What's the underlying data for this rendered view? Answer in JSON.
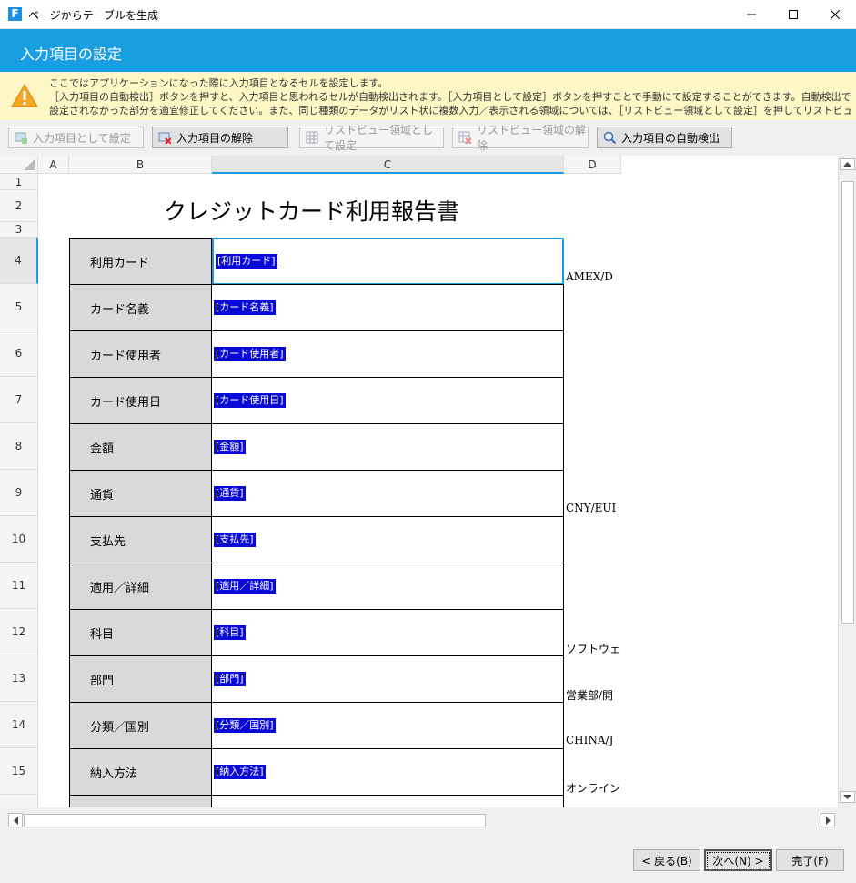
{
  "window": {
    "title": "ページからテーブルを生成",
    "app_icon_letter": "F"
  },
  "header": {
    "title": "入力項目の設定"
  },
  "info": {
    "lines": [
      "ここではアプリケーションになった際に入力項目となるセルを設定します。",
      "［入力項目の自動検出］ボタンを押すと、入力項目と思われるセルが自動検出されます。［入力項目として設定］ボタンを押すことで手動にて設定することができます。自動検出でうまく",
      "設定されなかった部分を適宜修正してください。また、同じ種類のデータがリスト状に複数入力／表示される領域については、［リストビュー領域として設定］を押してリストビュー領域とし…"
    ]
  },
  "toolbar": {
    "set_input": "入力項目として設定",
    "unset_input": "入力項目の解除",
    "set_listview": "リストビュー領域として設定",
    "unset_listview": "リストビュー領域の解除",
    "auto_detect": "入力項目の自動検出"
  },
  "sheet": {
    "columns": [
      "A",
      "B",
      "C",
      "D"
    ],
    "rows": [
      "1",
      "2",
      "3",
      "4",
      "5",
      "6",
      "7",
      "8",
      "9",
      "10",
      "11",
      "12",
      "13",
      "14",
      "15"
    ],
    "report_title": "クレジットカード利用報告書",
    "items": [
      {
        "label": "利用カード",
        "tag": "[利用カード]",
        "d": "AMEX/D"
      },
      {
        "label": "カード名義",
        "tag": "[カード名義]",
        "d": ""
      },
      {
        "label": "カード使用者",
        "tag": "[カード使用者]",
        "d": ""
      },
      {
        "label": "カード使用日",
        "tag": "[カード使用日]",
        "d": ""
      },
      {
        "label": "金額",
        "tag": "[金額]",
        "d": ""
      },
      {
        "label": "通貨",
        "tag": "[通貨]",
        "d": "CNY/EUI"
      },
      {
        "label": "支払先",
        "tag": "[支払先]",
        "d": ""
      },
      {
        "label": "適用／詳細",
        "tag": "[適用／詳細]",
        "d": ""
      },
      {
        "label": "科目",
        "tag": "[科目]",
        "d": "ソフトウェ"
      },
      {
        "label": "部門",
        "tag": "[部門]",
        "d": "営業部/開"
      },
      {
        "label": "分類／国別",
        "tag": "[分類／国別]",
        "d": "CHINA/J"
      },
      {
        "label": "納入方法",
        "tag": "[納入方法]",
        "d": "オンライン"
      }
    ]
  },
  "footer": {
    "back": "< 戻る(B)",
    "next": "次へ(N) >",
    "finish": "完了(F)"
  },
  "colors": {
    "accent": "#1a9ee2",
    "tag_bg": "#0a0ad8",
    "warning_bg": "#fdf7c5"
  }
}
